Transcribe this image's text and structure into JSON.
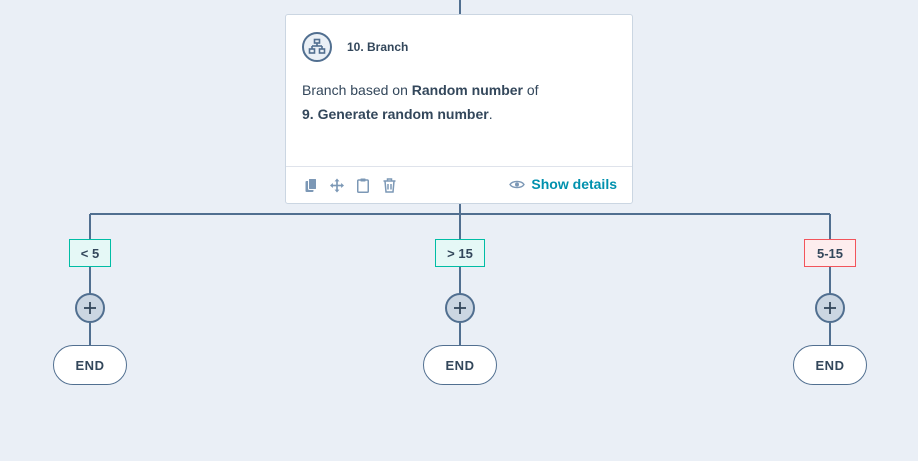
{
  "card": {
    "title": "10. Branch",
    "body_prefix": "Branch based on ",
    "body_bold1": "Random number",
    "body_mid": " of",
    "body_bold2": "9. Generate random number",
    "body_suffix": ".",
    "show_details_label": "Show details",
    "icons": [
      "branch-icon",
      "copy-icon",
      "move-icon",
      "clipboard-icon",
      "trash-icon",
      "eye-icon"
    ]
  },
  "branches": [
    {
      "label": "< 5",
      "end_label": "END",
      "color": "#00bda5"
    },
    {
      "label": "> 15",
      "end_label": "END",
      "color": "#00bda5"
    },
    {
      "label": "5-15",
      "end_label": "END",
      "color": "#f2545b"
    }
  ],
  "colors": {
    "background": "#eaeff6",
    "connector": "#516f90",
    "link": "#0091ae"
  }
}
